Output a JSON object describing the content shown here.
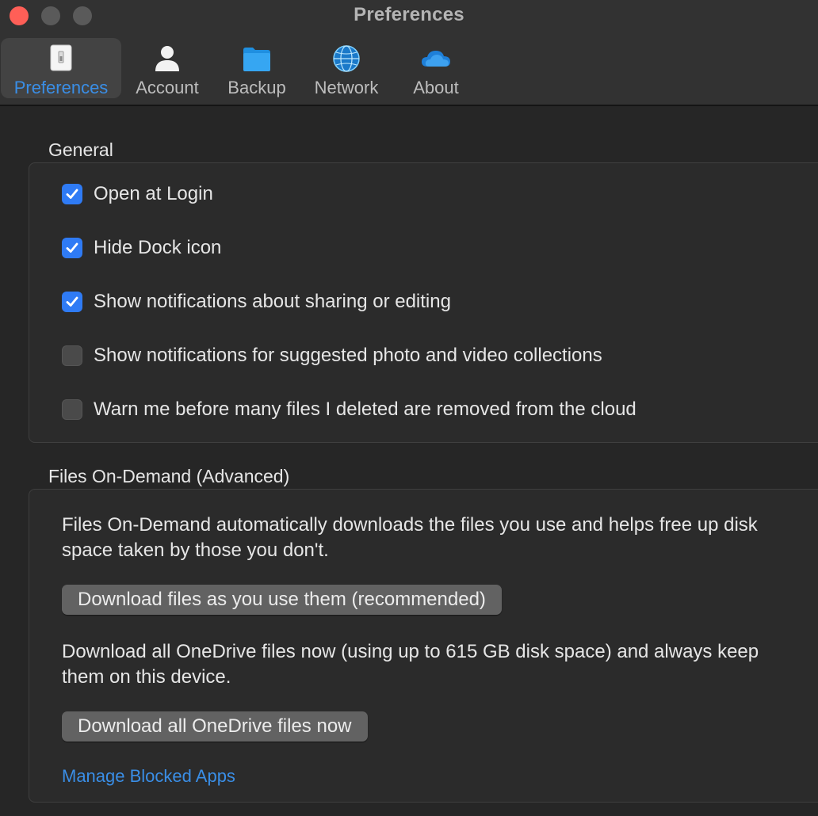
{
  "window": {
    "title": "Preferences"
  },
  "tabs": [
    {
      "label": "Preferences",
      "icon": "switch-icon",
      "selected": true
    },
    {
      "label": "Account",
      "icon": "person-icon",
      "selected": false
    },
    {
      "label": "Backup",
      "icon": "folder-icon",
      "selected": false
    },
    {
      "label": "Network",
      "icon": "globe-icon",
      "selected": false
    },
    {
      "label": "About",
      "icon": "cloud-icon",
      "selected": false
    }
  ],
  "general": {
    "title": "General",
    "options": [
      {
        "label": "Open at Login",
        "checked": true
      },
      {
        "label": "Hide Dock icon",
        "checked": true
      },
      {
        "label": "Show notifications about sharing or editing",
        "checked": true
      },
      {
        "label": "Show notifications for suggested photo and video collections",
        "checked": false
      },
      {
        "label": "Warn me before many files I deleted are removed from the cloud",
        "checked": false
      }
    ]
  },
  "files_on_demand": {
    "title": "Files On-Demand (Advanced)",
    "description": "Files On-Demand automatically downloads the files you use and helps free up disk space taken by those you don't.",
    "download_as_used_button": "Download files as you use them (recommended)",
    "download_all_description": "Download all OneDrive files now (using up to 615 GB disk space) and always keep them on this device.",
    "download_all_button": "Download all OneDrive files now",
    "manage_blocked_link": "Manage Blocked Apps"
  },
  "colors": {
    "accent": "#2f7bf5",
    "link": "#3a8ee6",
    "close": "#ff5f57"
  }
}
